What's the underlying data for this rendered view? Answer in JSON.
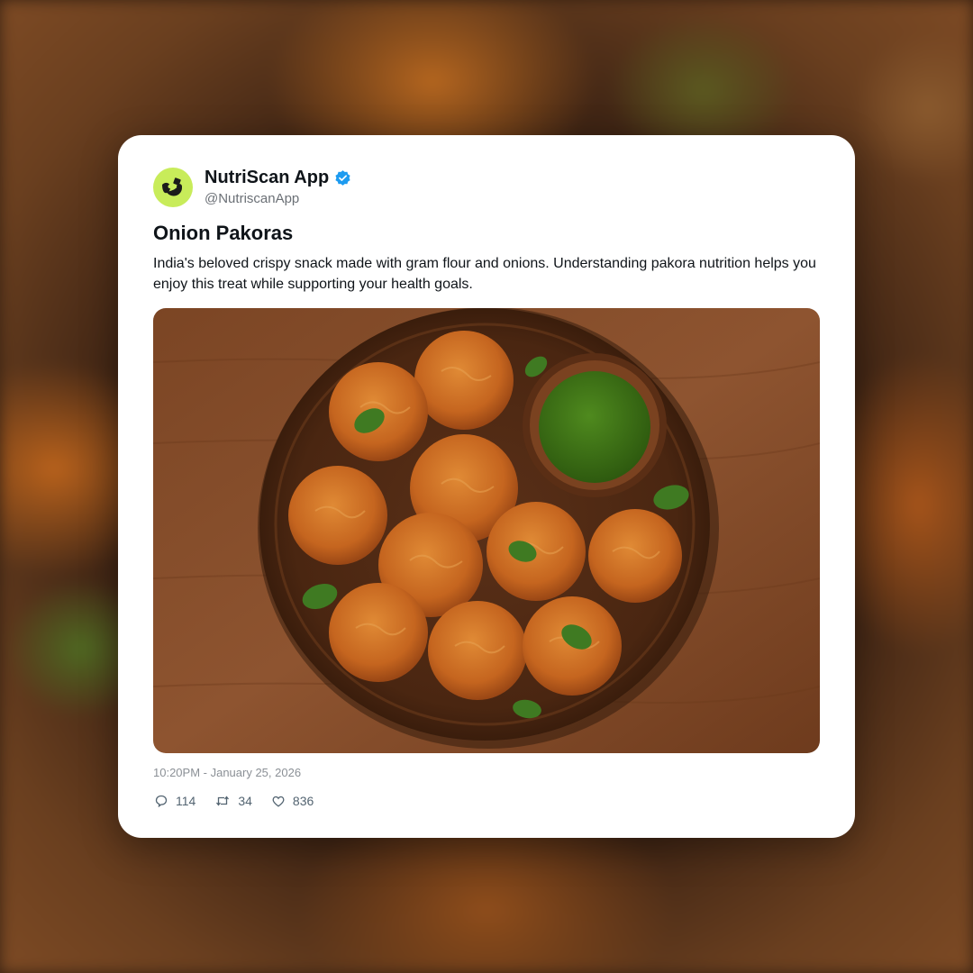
{
  "post": {
    "author": {
      "display_name": "NutriScan App",
      "handle": "@NutriscanApp",
      "verified": true,
      "avatar_color": "#c8ec5a",
      "verified_color": "#1d9bf0"
    },
    "title": "Onion Pakoras",
    "body": "India's beloved crispy snack made with gram flour and onions. Understanding pakora nutrition helps you enjoy this treat while supporting your health goals.",
    "image_icon": "onion-pakoras-photo",
    "timestamp": "10:20PM - January 25, 2026",
    "stats": {
      "replies": "114",
      "reposts": "34",
      "likes": "836"
    }
  },
  "icons": {
    "reply": "reply-icon",
    "repost": "repost-icon",
    "like": "heart-icon",
    "verified": "verified-badge-icon"
  }
}
